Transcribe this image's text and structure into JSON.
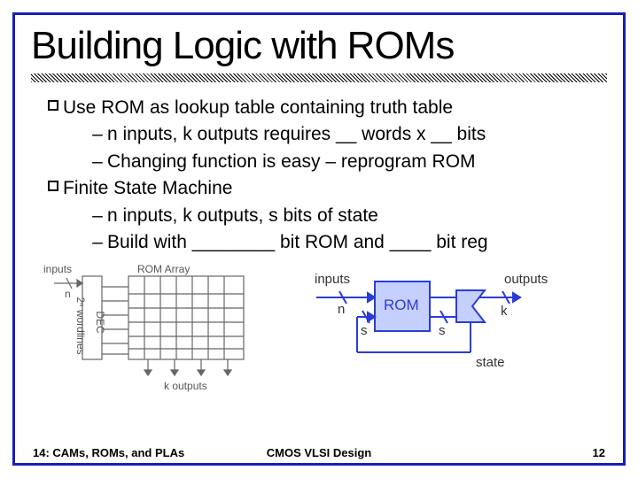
{
  "title": "Building Logic with ROMs",
  "bullets": [
    {
      "level": 0,
      "text": "Use ROM as lookup table containing truth table"
    },
    {
      "level": 1,
      "text": "n inputs, k outputs requires __ words x __ bits"
    },
    {
      "level": 1,
      "text": "Changing function is easy – reprogram ROM"
    },
    {
      "level": 0,
      "text": "Finite State Machine"
    },
    {
      "level": 1,
      "text": "n inputs, k outputs, s bits of state"
    },
    {
      "level": 1,
      "text": "Build with ________ bit ROM and ____ bit reg"
    }
  ],
  "diagram_rom": {
    "label_inputs": "inputs",
    "label_n": "n",
    "label_dec": "DEC",
    "label_wordlines": "2ⁿ wordlines",
    "label_array": "ROM Array",
    "label_koutputs": "k outputs"
  },
  "diagram_fsm": {
    "label_inputs": "inputs",
    "label_outputs": "outputs",
    "label_n": "n",
    "label_k": "k",
    "label_s1": "s",
    "label_s2": "s",
    "label_rom": "ROM",
    "label_state": "state"
  },
  "footer": {
    "left": "14: CAMs, ROMs, and PLAs",
    "center": "CMOS VLSI Design",
    "right": "12"
  }
}
